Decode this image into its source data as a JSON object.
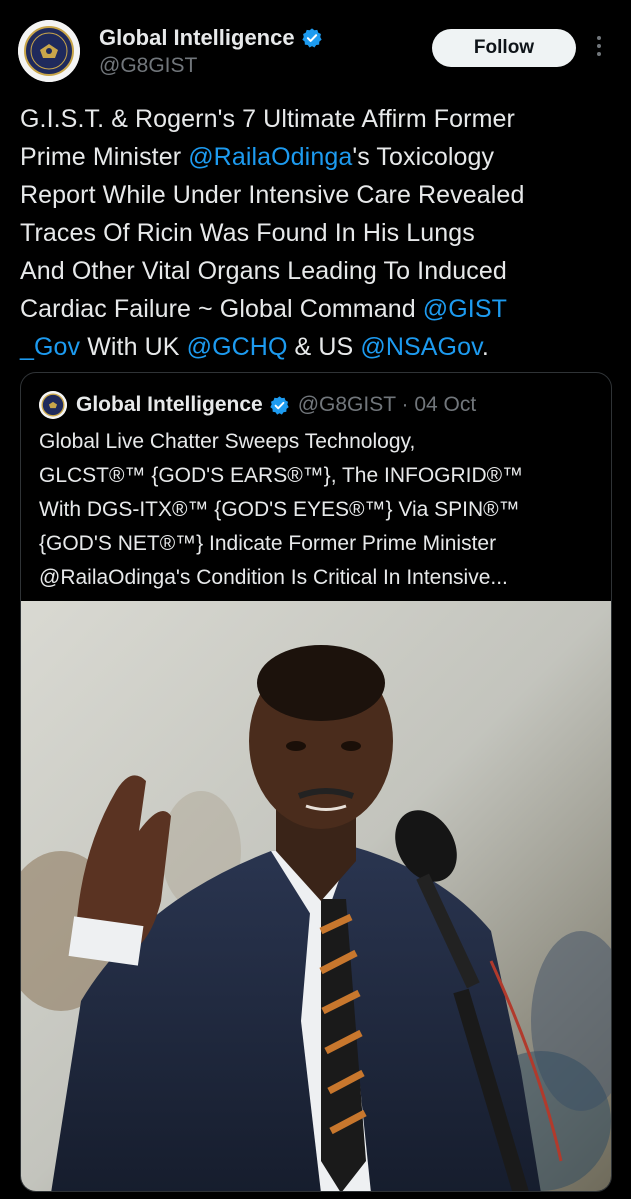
{
  "author": {
    "name": "Global Intelligence",
    "handle": "@G8GIST",
    "verified_icon": "verified-badge-icon",
    "avatar_icon": "seal-logo-icon"
  },
  "actions": {
    "follow_label": "Follow",
    "more_icon": "more-vertical-icon"
  },
  "tweet": {
    "lines": [
      [
        {
          "t": "G.I.S.T. & Rogern's 7 Ultimate Affirm Former"
        }
      ],
      [
        {
          "t": "Prime Minister "
        },
        {
          "t": "@RailaOdinga",
          "m": true
        },
        {
          "t": "'s Toxicology"
        }
      ],
      [
        {
          "t": "Report While Under Intensive Care Revealed"
        }
      ],
      [
        {
          "t": "Traces Of Ricin Was Found In His Lungs"
        }
      ],
      [
        {
          "t": "And Other Vital Organs Leading To Induced"
        }
      ],
      [
        {
          "t": "Cardiac Failure ~ Global Command "
        },
        {
          "t": "@GIST",
          "m": true
        }
      ],
      [
        {
          "t": "_Gov",
          "m": true
        },
        {
          "t": " With UK "
        },
        {
          "t": "@GCHQ",
          "m": true
        },
        {
          "t": " & US "
        },
        {
          "t": "@NSAGov",
          "m": true
        },
        {
          "t": "."
        }
      ]
    ]
  },
  "quote": {
    "name": "Global Intelligence",
    "handle_date": "@G8GIST · 04 Oct",
    "lines": [
      "Global Live Chatter Sweeps Technology,",
      "GLCST®™ {GOD'S EARS®™}, The INFOGRID®™",
      "With DGS-ITX®™ {GOD'S EYES®™} Via SPIN®™",
      "{GOD'S NET®™} Indicate Former Prime Minister",
      "@RailaOdinga's Condition Is Critical In Intensive..."
    ],
    "image_icon": "speaker-photo"
  },
  "colors": {
    "background": "#000000",
    "text": "#e7e9ea",
    "secondary": "#71767b",
    "mention": "#1d9bf0",
    "border": "#2f3336"
  }
}
